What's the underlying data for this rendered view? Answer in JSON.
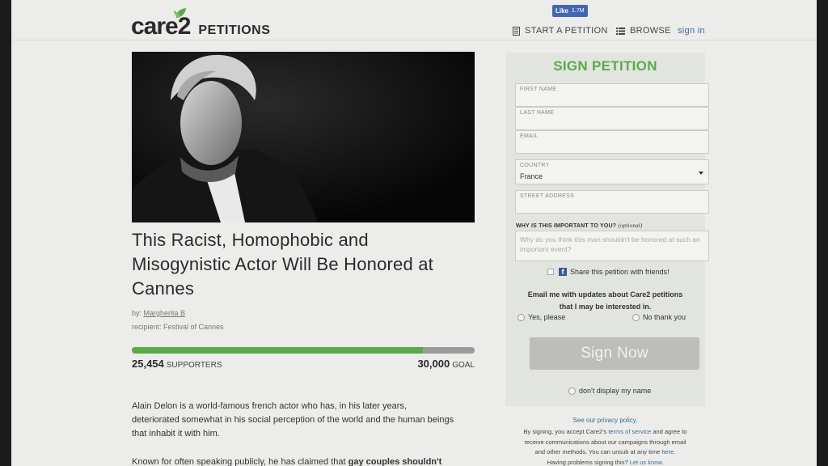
{
  "brand": {
    "name": "care2",
    "section": "PETITIONS"
  },
  "facebook": {
    "like_label": "Like",
    "like_count": "1.7M"
  },
  "nav": {
    "start": "START A PETITION",
    "browse": "BROWSE",
    "signin": "sign in"
  },
  "petition": {
    "title_lines": [
      "This Racist, Homophobic and",
      "Misogynistic Actor Will Be Honored at",
      "Cannes"
    ],
    "by_prefix": "by:",
    "author": "Margherita B",
    "recipient": "recipient: Festival of Cannes",
    "supporters_count": "25,454",
    "supporters_label": "SUPPORTERS",
    "goal_count": "30,000",
    "goal_label": "GOAL",
    "progress_fraction": 0.8485,
    "body_p1": [
      "Alain Delon is a world-famous french actor who has, in his later years,",
      "deteriorated somewhat in his social perception of the world and the human beings",
      "that inhabit it with him."
    ],
    "body_p2_start": "Known for often speaking publicly, he has claimed that ",
    "body_p2_bold": "gay couples shouldn't"
  },
  "form": {
    "title": "SIGN PETITION",
    "first_name_label": "FIRST NAME",
    "last_name_label": "LAST NAME",
    "email_label": "EMAIL",
    "country_label": "COUNTRY",
    "country_value": "France",
    "street_label": "STREET ADDRESS",
    "why_label": "WHY IS THIS IMPORTANT TO YOU?",
    "why_optional": "(optional)",
    "why_placeholder": "Why do you think this man shouldn't be honored at such an important event?",
    "share_label": "Share this petition with friends!",
    "email_question_1": "Email me with updates about Care2 petitions",
    "email_question_2": "that I may be interested in.",
    "yes_label": "Yes, please",
    "no_label": "No thank you",
    "submit": "Sign Now",
    "anon_label": "don't display my name"
  },
  "legal": {
    "privacy": "See our privacy policy.",
    "l1_a": "By signing, you accept Care2's ",
    "l1_link": "terms of service",
    "l1_b": " and agree to",
    "l2": "receive communications about our campaigns through email",
    "l3_a": "and other methods. You can unsub at any time ",
    "l3_link": "here",
    "l3_b": ".",
    "l4_a": "Having problems signing this? ",
    "l4_link": "Let us know",
    "l4_b": "."
  },
  "colors": {
    "brand_green": "#5aaa4a",
    "link_blue": "#3b6a9c",
    "facebook_blue": "#4267b2"
  },
  "icons": [
    "leaf-icon",
    "document-icon",
    "list-icon",
    "facebook-icon",
    "chevron-down-icon"
  ]
}
